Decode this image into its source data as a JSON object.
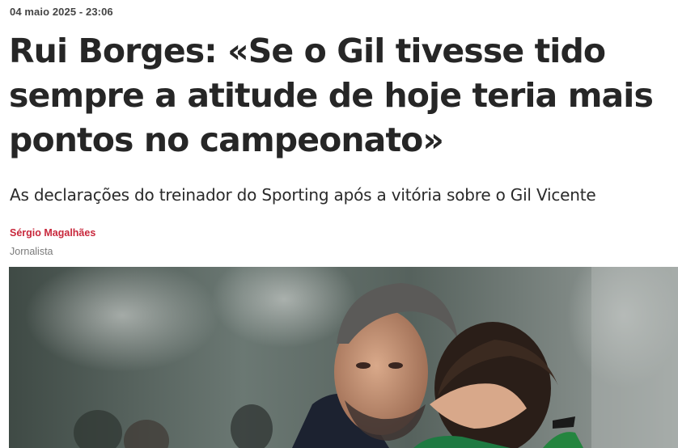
{
  "article": {
    "dateline": "04 maio 2025 - 23:06",
    "headline": "Rui Borges: «Se o Gil tivesse tido sempre a atitude de hoje teria mais pontos no campeonato»",
    "subtitle": "As declarações do treinador do Sporting após a vitória sobre o Gil Vicente",
    "author": {
      "name": "Sérgio Magalhães",
      "role": "Jornalista"
    }
  },
  "colors": {
    "author_accent": "#c8283c",
    "headline": "#262626",
    "muted": "#7a7a7a"
  }
}
